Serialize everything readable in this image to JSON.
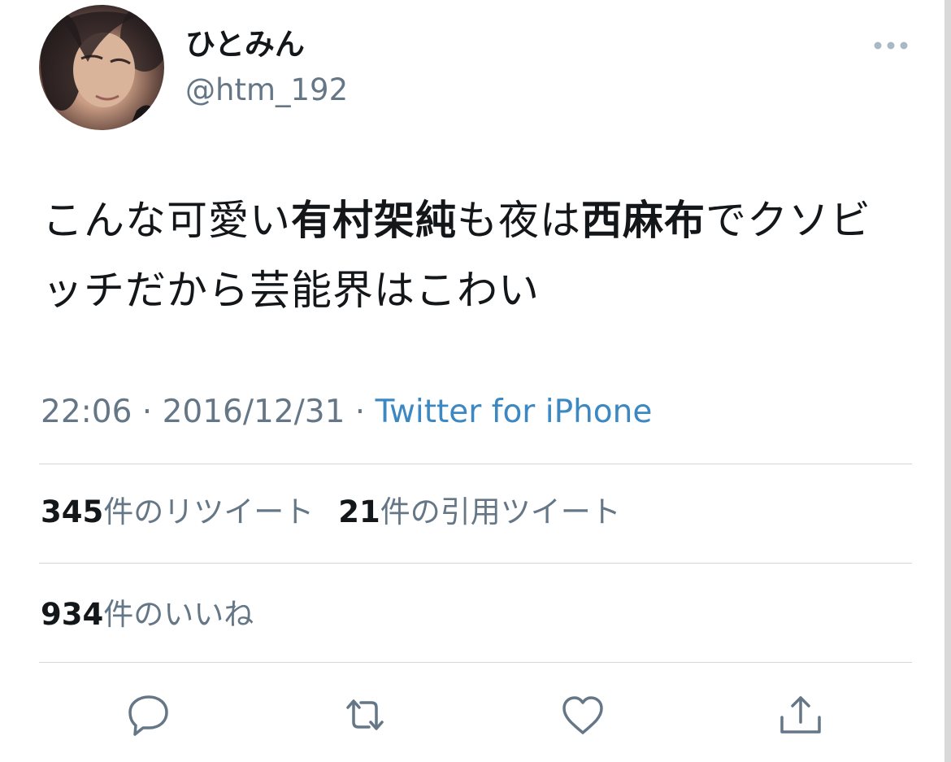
{
  "tweet": {
    "author": {
      "display_name": "ひとみん",
      "handle": "@htm_192"
    },
    "text": {
      "seg1": "こんな可愛い",
      "seg2_bold": "有村架純",
      "seg3": "も夜は",
      "seg4_bold": "西麻布",
      "seg5": "でクソビッチだから芸能界はこわい"
    },
    "time": "22:06",
    "separator1": " · ",
    "date": "2016/12/31",
    "separator2": " · ",
    "source": "Twitter for iPhone"
  },
  "stats": {
    "retweets_count": "345",
    "retweets_label": "件のリツイート",
    "quotes_count": "21",
    "quotes_label": "件の引用ツイート",
    "likes_count": "934",
    "likes_label": "件のいいね"
  },
  "icons": {
    "more": "more-dots-icon",
    "reply": "reply-icon",
    "retweet": "retweet-icon",
    "like": "heart-icon",
    "share": "share-icon"
  },
  "colors": {
    "text_primary": "#14171a",
    "text_secondary": "#657786",
    "link": "#3b88c3",
    "divider": "#cfd6dc"
  }
}
